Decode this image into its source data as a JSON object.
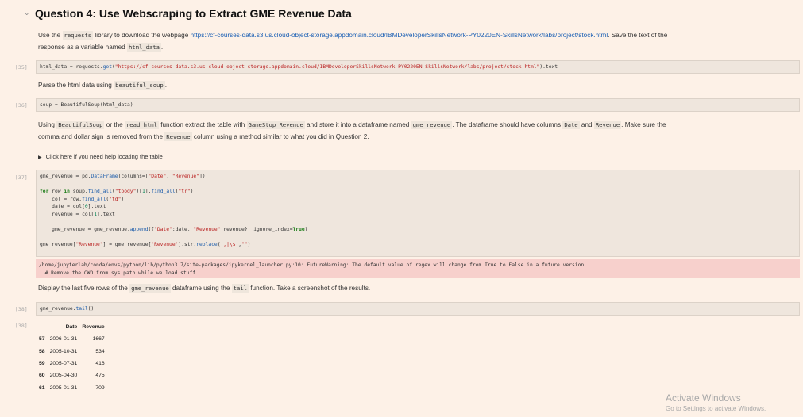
{
  "heading": {
    "chevron": "⌄",
    "title": "Question 4: Use Webscraping to Extract GME Revenue Data"
  },
  "md1": {
    "pre": "Use the ",
    "code1": "requests",
    "mid": " library to download the webpage ",
    "link": "https://cf-courses-data.s3.us.cloud-object-storage.appdomain.cloud/IBMDeveloperSkillsNetwork-PY0220EN-SkillsNetwork/labs/project/stock.html",
    "post": ". Save the text of the",
    "line2": "response as a variable named ",
    "code2": "html_data",
    "end": "."
  },
  "cell35": {
    "prompt": "[35]:",
    "p1": "html_data = requests.",
    "fn": "get",
    "p2": "(",
    "str": "\"https://cf-courses-data.s3.us.cloud-object-storage.appdomain.cloud/IBMDeveloperSkillsNetwork-PY0220EN-SkillsNetwork/labs/project/stock.html\"",
    "p3": ").text"
  },
  "md2": {
    "pre": "Parse the html data using ",
    "code": "beautiful_soup",
    "end": "."
  },
  "cell36": {
    "prompt": "[36]:",
    "code": "soup = BeautifulSoup(html_data)"
  },
  "md3": {
    "a": "Using ",
    "c1": "BeautifulSoup",
    "b": " or the ",
    "c2": "read_html",
    "c": " function extract the table with ",
    "c3": "GameStop Revenue",
    "d": " and store it into a dataframe named ",
    "c4": "gme_revenue",
    "e": ". The dataframe should have columns ",
    "c5": "Date",
    "f": " and ",
    "c6": "Revenue",
    "g": ". Make sure the",
    "line2a": "comma and dollar sign is removed from the ",
    "c7": "Revenue",
    "line2b": " column using a method similar to what you did in Question 2."
  },
  "details": {
    "marker": "▶",
    "text": "Click here if you need help locating the table"
  },
  "cell37": {
    "prompt": "[37]:",
    "l1a": "gme_revenue = pd.",
    "l1fn": "DataFrame",
    "l1b": "(columns=[",
    "l1s1": "\"Date\"",
    "l1c": ", ",
    "l1s2": "\"Revenue\"",
    "l1d": "])",
    "l3kw1": "for",
    "l3a": " row ",
    "l3kw2": "in",
    "l3b": " soup.",
    "l3fn": "find_all",
    "l3c": "(",
    "l3s": "\"tbody\"",
    "l3d": ")[",
    "l3n": "1",
    "l3e": "].",
    "l3fn2": "find_all",
    "l3f": "(",
    "l3s2": "\"tr\"",
    "l3g": "):",
    "l4a": "    col = row.",
    "l4fn": "find_all",
    "l4b": "(",
    "l4s": "\"td\"",
    "l4c": ")",
    "l5a": "    date = col[",
    "l5n": "0",
    "l5b": "].text",
    "l6a": "    revenue = col[",
    "l6n": "1",
    "l6b": "].text",
    "l8a": "    gme_revenue = gme_revenue.",
    "l8fn": "append",
    "l8b": "({",
    "l8s1": "\"Date\"",
    "l8c": ":date, ",
    "l8s2": "\"Revenue\"",
    "l8d": ":revenue}, ignore_index=",
    "l8kw": "True",
    "l8e": ")",
    "l10a": "gme_revenue[",
    "l10s1": "\"Revenue\"",
    "l10b": "] = gme_revenue[",
    "l10s2": "'Revenue'",
    "l10c": "].str.",
    "l10fn": "replace",
    "l10d": "(",
    "l10s3": "',|\\$'",
    "l10e": ",",
    "l10s4": "\"\"",
    "l10f": ")"
  },
  "warning": {
    "line1": "/home/jupyterlab/conda/envs/python/lib/python3.7/site-packages/ipykernel_launcher.py:10: FutureWarning: The default value of regex will change from True to False in a future version.",
    "line2": "  # Remove the CWD from sys.path while we load stuff."
  },
  "md4": {
    "pre": "Display the last five rows of the ",
    "c1": "gme_revenue",
    "mid": " dataframe using the ",
    "c2": "tail",
    "post": " function. Take a screenshot of the results."
  },
  "cell38": {
    "prompt": "[38]:",
    "a": "gme_revenue.",
    "fn": "tail",
    "b": "()"
  },
  "out38": {
    "prompt": "[38]:"
  },
  "table": {
    "headers": [
      "",
      "Date",
      "Revenue"
    ],
    "rows": [
      [
        "57",
        "2006-01-31",
        "1667"
      ],
      [
        "58",
        "2005-10-31",
        "534"
      ],
      [
        "59",
        "2005-07-31",
        "416"
      ],
      [
        "60",
        "2005-04-30",
        "475"
      ],
      [
        "61",
        "2005-01-31",
        "709"
      ]
    ]
  },
  "watermark": {
    "title": "Activate Windows",
    "sub": "Go to Settings to activate Windows."
  }
}
